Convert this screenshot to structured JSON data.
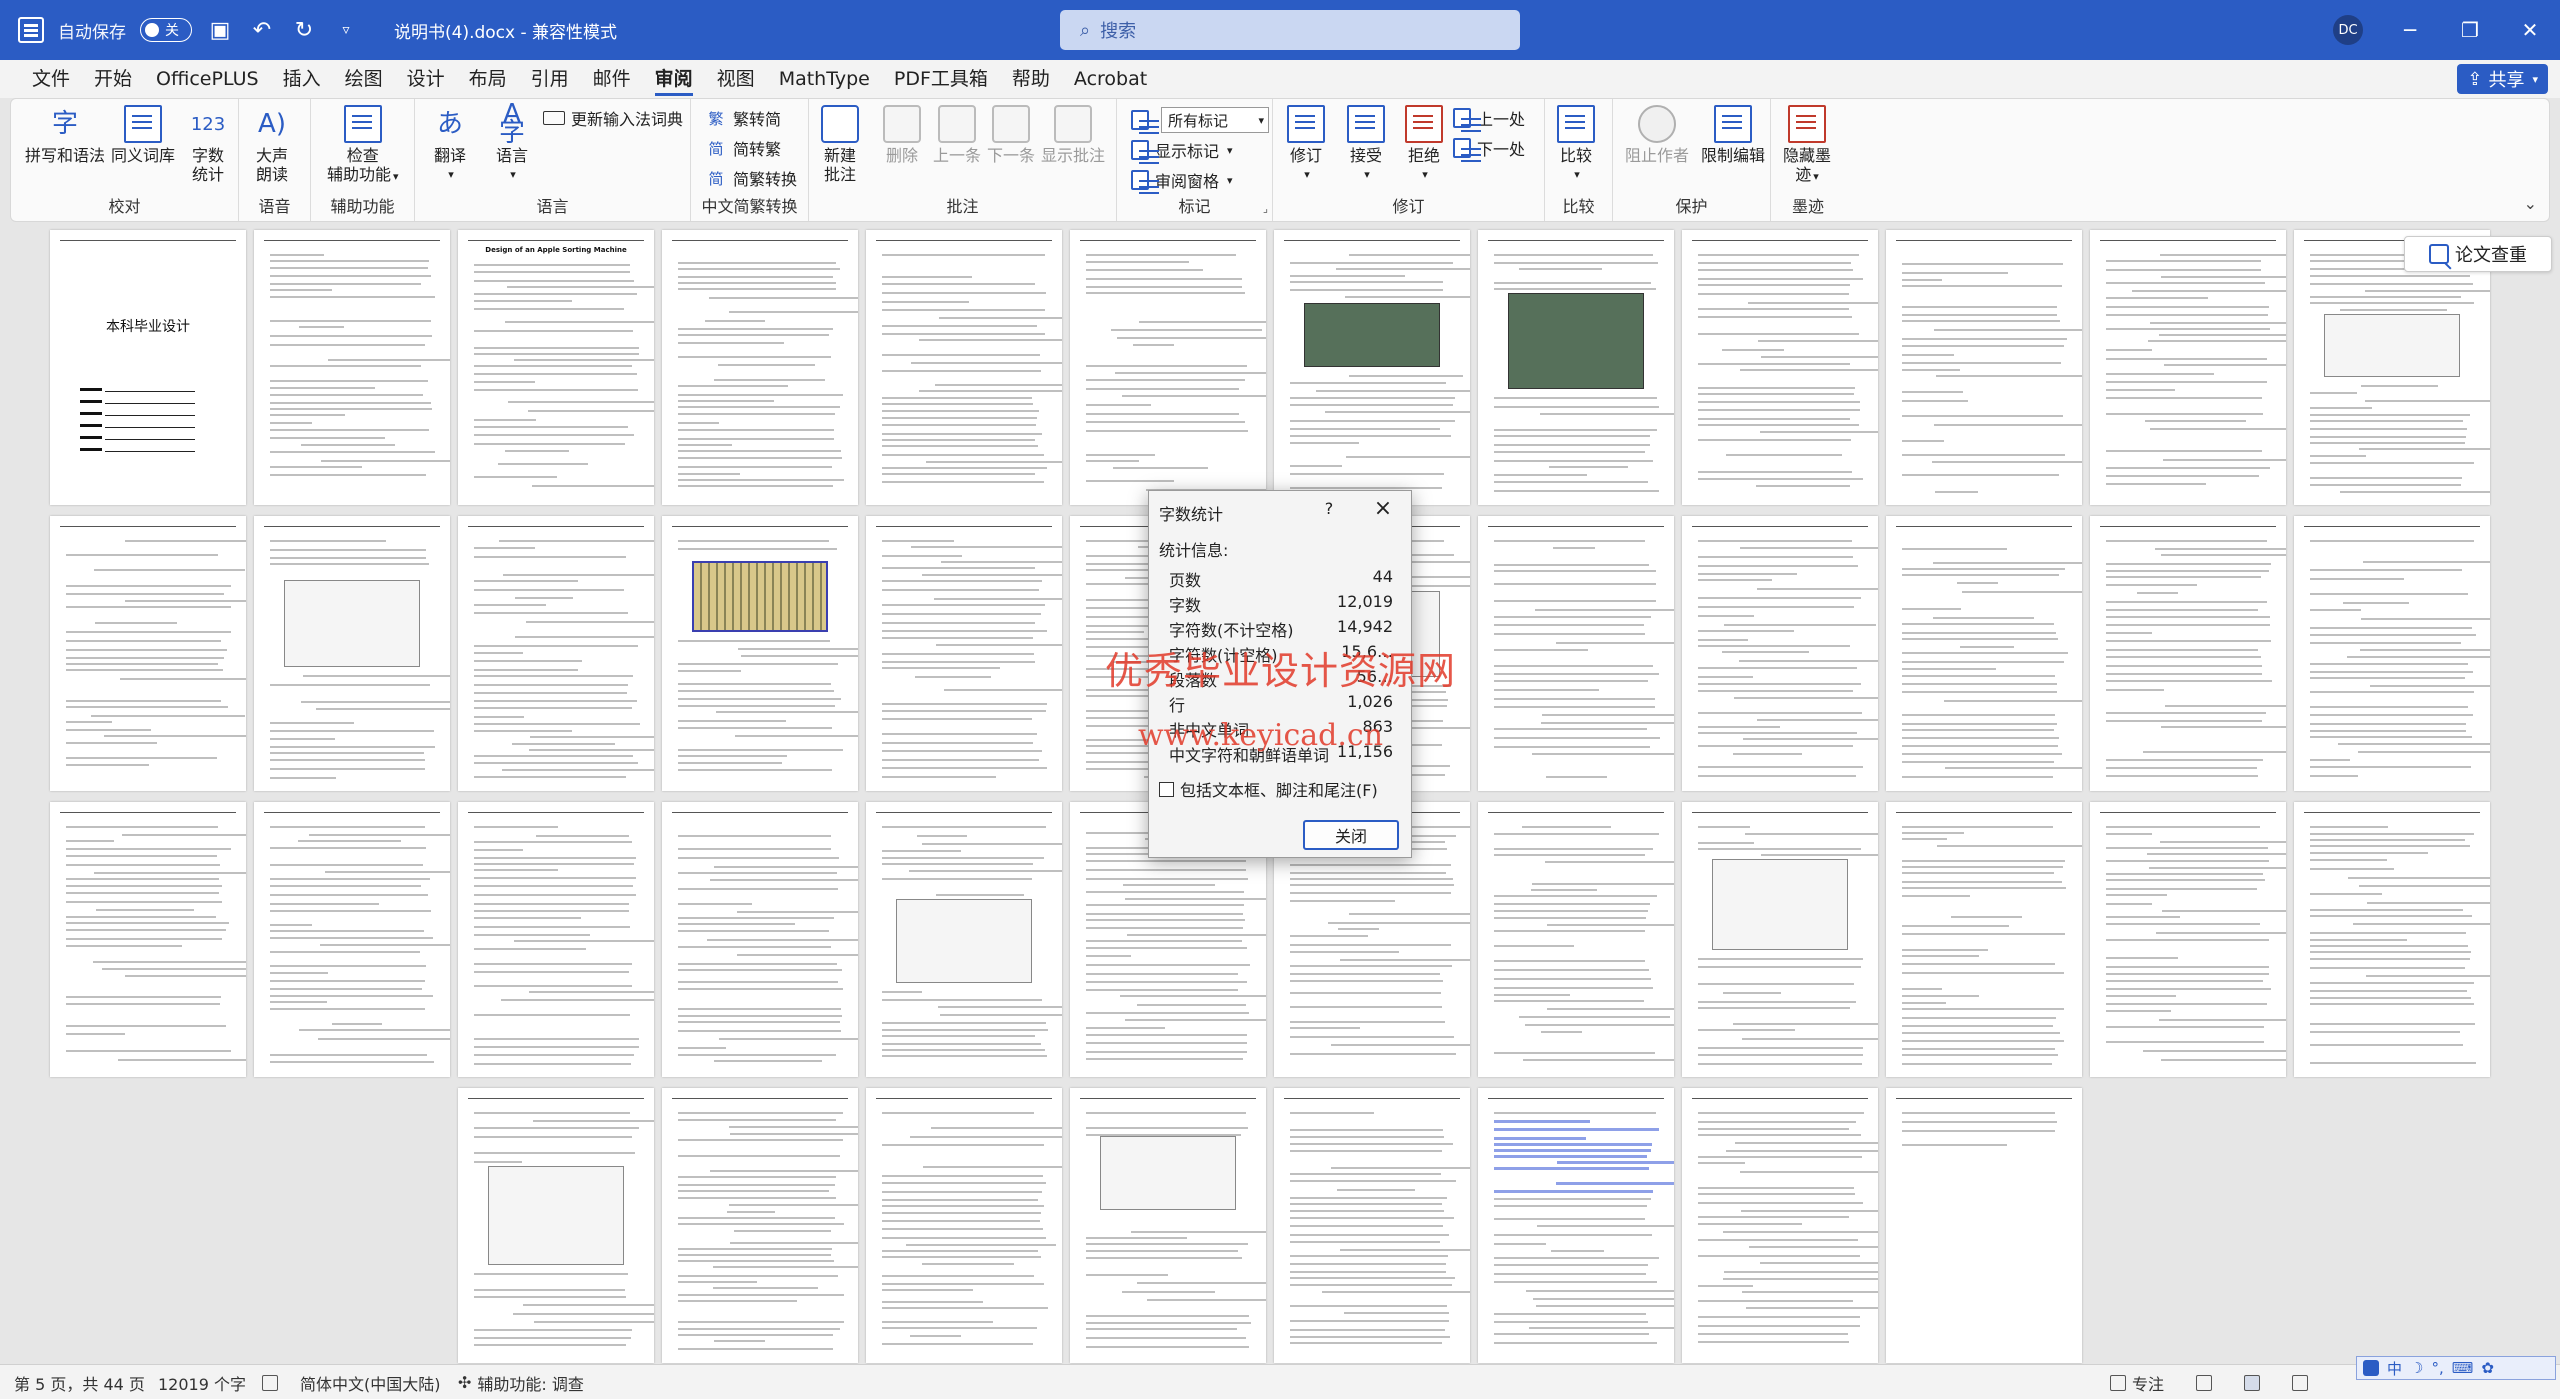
{
  "titlebar": {
    "autosave_label": "自动保存",
    "autosave_state": "关",
    "doc_title": "说明书(4).docx - 兼容性模式",
    "search_placeholder": "搜索",
    "user_initials": "DC"
  },
  "menu": {
    "tabs": [
      "文件",
      "开始",
      "OfficePLUS",
      "插入",
      "绘图",
      "设计",
      "布局",
      "引用",
      "邮件",
      "审阅",
      "视图",
      "MathType",
      "PDF工具箱",
      "帮助",
      "Acrobat"
    ],
    "active_tab": "审阅",
    "share_label": "共享"
  },
  "ribbon": {
    "proofing": {
      "label": "校对",
      "spelling": "拼写和语法",
      "thesaurus": "同义词库",
      "wordcount_line1": "字数",
      "wordcount_line2": "统计"
    },
    "speech": {
      "label": "语音",
      "read_line1": "大声",
      "read_line2": "朗读"
    },
    "accessibility": {
      "label": "辅助功能",
      "check_line1": "检查",
      "check_line2": "辅助功能"
    },
    "language": {
      "label": "语言",
      "translate": "翻译",
      "language": "语言",
      "ime_dict": "更新输入法词典"
    },
    "chinese": {
      "label": "中文简繁转换",
      "to_simplified": "繁转简",
      "to_traditional": "简转繁",
      "convert": "简繁转换"
    },
    "comments": {
      "label": "批注",
      "new_line1": "新建",
      "new_line2": "批注",
      "delete": "删除",
      "prev": "上一条",
      "next": "下一条",
      "show": "显示批注"
    },
    "tracking": {
      "label": "标记",
      "markup_select": "所有标记",
      "show_markup": "显示标记",
      "review_pane": "审阅窗格"
    },
    "changes": {
      "label": "修订",
      "track": "修订",
      "accept": "接受",
      "reject": "拒绝",
      "previous": "上一处",
      "next": "下一处"
    },
    "compare": {
      "label": "比较",
      "compare": "比较"
    },
    "protect": {
      "label": "保护",
      "block_authors": "阻止作者",
      "restrict": "限制编辑"
    },
    "ink": {
      "label": "墨迹",
      "hide_line1": "隐藏墨",
      "hide_line2": "迹"
    }
  },
  "lunwen_button": "论文查重",
  "cover": {
    "title": "本科毕业设计"
  },
  "page3": {
    "title": "Design of an Apple Sorting Machine"
  },
  "dialog": {
    "title": "字数统计",
    "help": "?",
    "section": "统计信息:",
    "stats": [
      {
        "label": "页数",
        "value": "44"
      },
      {
        "label": "字数",
        "value": "12,019"
      },
      {
        "label": "字符数(不计空格)",
        "value": "14,942"
      },
      {
        "label": "字符数(计空格)",
        "value": "15,6…"
      },
      {
        "label": "段落数",
        "value": "56…"
      },
      {
        "label": "行",
        "value": "1,026"
      },
      {
        "label": "非中文单词",
        "value": "863"
      },
      {
        "label": "中文字符和朝鲜语单词",
        "value": "11,156"
      }
    ],
    "include_label": "包括文本框、脚注和尾注(F)",
    "close_label": "关闭"
  },
  "watermark": {
    "line1": "优秀毕业设计资源网",
    "line2": "www.keyicad.cn"
  },
  "status": {
    "page": "第 5 页，共 44 页",
    "words": "12019 个字",
    "language": "简体中文(中国大陆)",
    "accessibility": "辅助功能: 调查",
    "focus": "专注"
  },
  "ime": {
    "mode": "中"
  }
}
